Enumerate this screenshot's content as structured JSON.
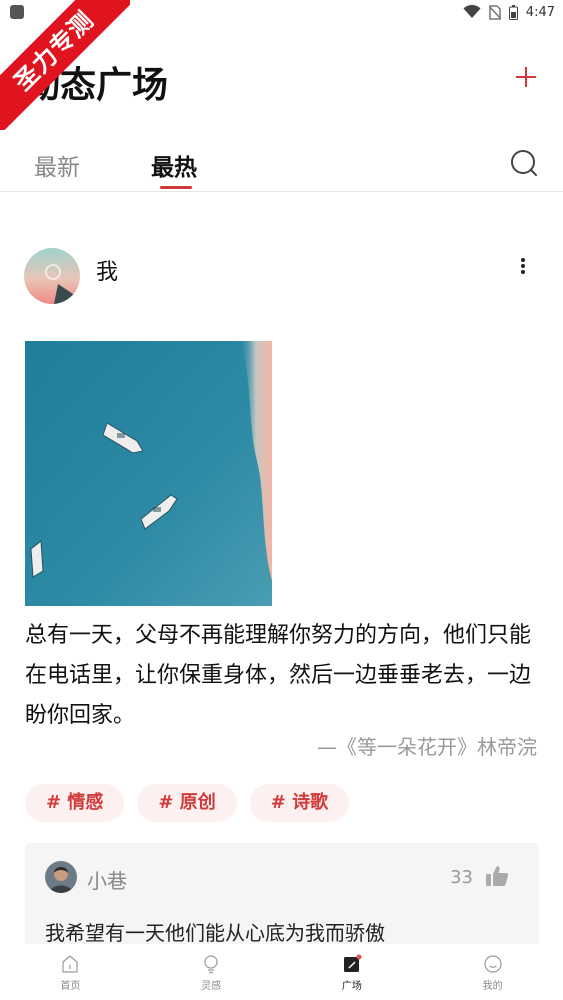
{
  "status_bar": {
    "time": "4:47"
  },
  "ribbon": {
    "text": "圣力专测"
  },
  "header": {
    "title": "动态广场"
  },
  "tabs": [
    {
      "label": "最新",
      "active": false
    },
    {
      "label": "最热",
      "active": true
    }
  ],
  "post": {
    "author": "我",
    "text": "总有一天，父母不再能理解你努力的方向，他们只能在电话里，让你保重身体，然后一边垂垂老去，一边盼你回家。",
    "source": "—《等一朵花开》林帝浣",
    "tags": [
      "# 情感",
      "# 原创",
      "# 诗歌"
    ],
    "comment": {
      "user": "小巷",
      "likes": "33",
      "text": "我希望有一天他们能从心底为我而骄傲"
    }
  },
  "bottom_nav": [
    {
      "label": "首页",
      "icon": "home-icon"
    },
    {
      "label": "灵感",
      "icon": "lightbulb-icon"
    },
    {
      "label": "广场",
      "icon": "square-icon",
      "active": true
    },
    {
      "label": "我的",
      "icon": "profile-icon"
    }
  ],
  "colors": {
    "accent": "#d23a3a",
    "ribbon": "#e0141e",
    "tag_bg": "#fdf0f0"
  }
}
